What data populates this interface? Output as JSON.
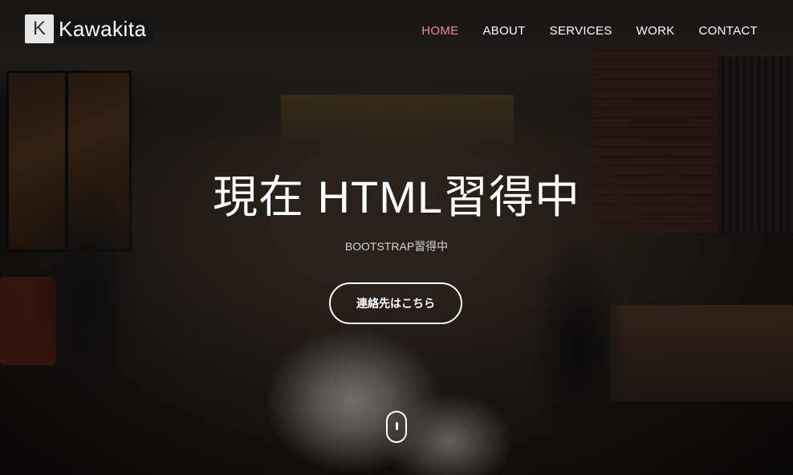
{
  "brand": {
    "mark": "K",
    "name": "Kawakita"
  },
  "nav": {
    "items": [
      {
        "label": "HOME",
        "active": true
      },
      {
        "label": "ABOUT",
        "active": false
      },
      {
        "label": "SERVICES",
        "active": false
      },
      {
        "label": "WORK",
        "active": false
      },
      {
        "label": "CONTACT",
        "active": false
      }
    ]
  },
  "hero": {
    "headline": "現在 HTML習得中",
    "subheadline": "BOOTSTRAP習得中",
    "cta_label": "連絡先はこちら"
  },
  "colors": {
    "active_nav": "#f08a9a",
    "text": "#ffffff"
  },
  "icons": {
    "scroll": "mouse-scroll-icon"
  }
}
